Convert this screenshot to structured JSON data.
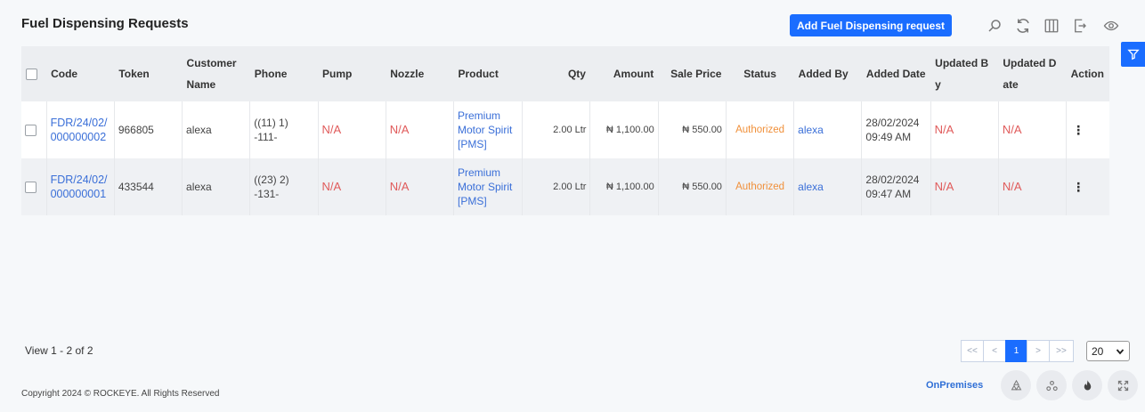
{
  "page": {
    "title": "Fuel Dispensing Requests"
  },
  "toolbar": {
    "add_label": "Add Fuel Dispensing request",
    "icons": [
      "search-icon",
      "refresh-icon",
      "columns-icon",
      "export-icon",
      "eye-icon"
    ],
    "accent": "#1a6dff"
  },
  "table": {
    "columns": [
      "Code",
      "Token",
      "Customer Name",
      "Phone",
      "Pump",
      "Nozzle",
      "Product",
      "Qty",
      "Amount",
      "Sale Price",
      "Status",
      "Added By",
      "Added Date",
      "Updated By",
      "Updated Date",
      "Action"
    ],
    "rows": [
      {
        "code": "FDR/24/02/000000002",
        "token": "966805",
        "customer": "alexa",
        "phone": "((11) 1) -111-",
        "pump": "N/A",
        "nozzle": "N/A",
        "product": "Premium Motor Spirit [PMS]",
        "qty": "2.00 Ltr",
        "amount": "₦ 1,100.00",
        "sale_price": "₦ 550.00",
        "status": "Authorized",
        "added_by": "alexa",
        "added_date": "28/02/2024 09:49 AM",
        "updated_by": "N/A",
        "updated_date": "N/A"
      },
      {
        "code": "FDR/24/02/000000001",
        "token": "433544",
        "customer": "alexa",
        "phone": "((23) 2) -131-",
        "pump": "N/A",
        "nozzle": "N/A",
        "product": "Premium Motor Spirit [PMS]",
        "qty": "2.00 Ltr",
        "amount": "₦ 1,100.00",
        "sale_price": "₦ 550.00",
        "status": "Authorized",
        "added_by": "alexa",
        "added_date": "28/02/2024 09:47 AM",
        "updated_by": "N/A",
        "updated_date": "N/A"
      }
    ]
  },
  "pagination": {
    "info": "View 1 - 2 of 2",
    "first": "<<",
    "prev": "<",
    "current": "1",
    "next": ">",
    "last": ">>",
    "page_size": "20"
  },
  "footer": {
    "copyright": "Copyright 2024 © ROCKEYE. All Rights Reserved",
    "mode": "OnPremises"
  }
}
